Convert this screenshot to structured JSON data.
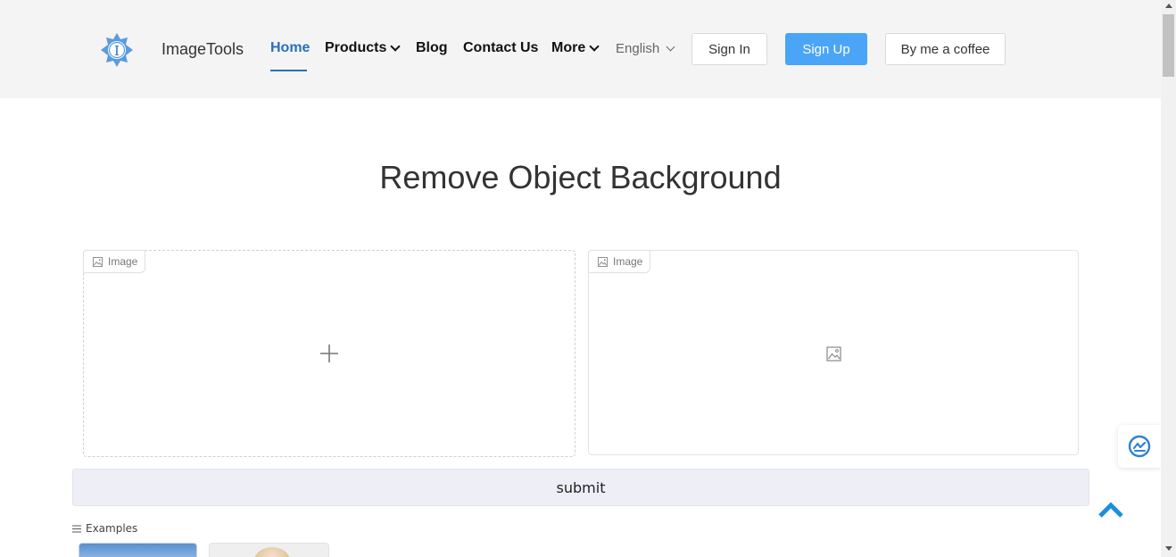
{
  "header": {
    "brand": "ImageTools",
    "nav": {
      "home": "Home",
      "products": "Products",
      "blog": "Blog",
      "contact": "Contact Us",
      "more": "More"
    },
    "language": "English",
    "sign_in": "Sign In",
    "sign_up": "Sign Up",
    "coffee": "By me a coffee",
    "logo_letter": "I"
  },
  "main": {
    "title": "Remove Object Background",
    "input_panel": {
      "tag": "Image"
    },
    "output_panel": {
      "tag": "Image"
    },
    "submit_label": "submit",
    "examples_label": "Examples"
  },
  "icons": {
    "logo": "snowflake-logo-icon",
    "upload": "plus-icon",
    "placeholder": "image-icon",
    "examples": "list-icon",
    "widget": "translate-widget-icon",
    "back_to_top": "chevron-up-icon"
  },
  "colors": {
    "accent": "#2a6fc1",
    "primary_button": "#4aa5f7",
    "header_bg": "#f4f4f4",
    "submit_bg": "#eeeff6"
  }
}
